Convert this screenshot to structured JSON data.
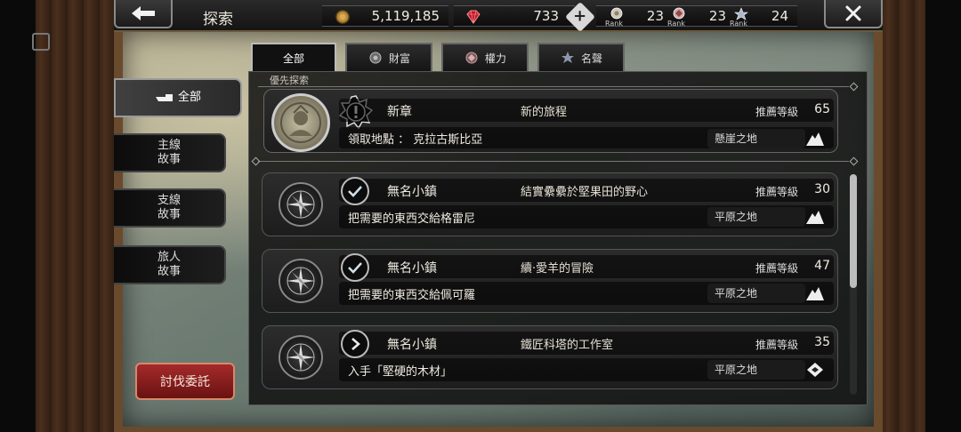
{
  "header": {
    "title": "探索",
    "coins": "5,119,185",
    "gems": "733",
    "ranks": [
      {
        "label": "Rank",
        "value": "23"
      },
      {
        "label": "Rank",
        "value": "23"
      },
      {
        "label": "Rank",
        "value": "24"
      }
    ]
  },
  "categories": [
    {
      "label": "全部",
      "icon": "none"
    },
    {
      "label": "財富",
      "icon": "wealth-icon"
    },
    {
      "label": "權力",
      "icon": "power-icon"
    },
    {
      "label": "名聲",
      "icon": "fame-icon"
    }
  ],
  "side_tabs": [
    {
      "label": "全部"
    },
    {
      "line1": "主線",
      "line2": "故事"
    },
    {
      "line1": "支線",
      "line2": "故事"
    },
    {
      "line1": "旅人",
      "line2": "故事"
    }
  ],
  "hunt_button": "討伐委託",
  "section_label": "優先探索",
  "featured": {
    "name": "新章",
    "subtitle": "新的旅程",
    "rec_label": "推薦等級",
    "rec_value": "65",
    "task": "領取地點 ： 克拉古斯比亞",
    "region": "懸崖之地"
  },
  "quests": [
    {
      "name": "無名小鎮",
      "subtitle": "結實纍纍於堅果田的野心",
      "rec_label": "推薦等級",
      "rec_value": "30",
      "task": "把需要的東西交給格雷尼",
      "region": "平原之地",
      "status": "completed"
    },
    {
      "name": "無名小鎮",
      "subtitle": "續·愛羊的冒險",
      "rec_label": "推薦等級",
      "rec_value": "47",
      "task": "把需要的東西交給佩可羅",
      "region": "平原之地",
      "status": "completed"
    },
    {
      "name": "無名小鎮",
      "subtitle": "鐵匠科塔的工作室",
      "rec_label": "推薦等級",
      "rec_value": "35",
      "task": "入手「堅硬的木材」",
      "region": "平原之地",
      "status": "in-progress"
    }
  ]
}
